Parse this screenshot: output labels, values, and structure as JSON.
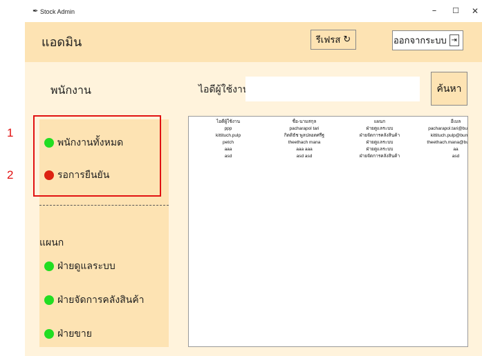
{
  "window": {
    "title": "Stock Admin",
    "minimize": "–",
    "maximize": "☐",
    "close": "✕"
  },
  "header": {
    "title": "แอดมิน",
    "refresh_label": "รีเฟรส",
    "refresh_icon_glyph": "↻",
    "logout_label": "ออกจากระบบ",
    "logout_icon_glyph": "⇥"
  },
  "main": {
    "section_title": "พนักงาน",
    "userid_label": "ไอดีผู้ใช้งาน",
    "userid_value": "",
    "search_label": "ค้นหา"
  },
  "sidebar": {
    "all_label": "พนักงานทั้งหมด",
    "pending_label": "รอการยืนยัน",
    "dept_title": "แผนก",
    "depts": [
      "ฝ่ายดูแลระบบ",
      "ฝ่ายจัดการคลังสินค้า",
      "ฝ่ายขาย"
    ]
  },
  "annotations": {
    "one": "1",
    "two": "2"
  },
  "table": {
    "headers": [
      "ไอดีผู้ใช้งาน",
      "ชื่อ-นามสกุล",
      "แผนก",
      "อีเมล"
    ],
    "rows": [
      [
        "ppp",
        "pacharapol tari",
        "ฝ่ายดูแลระบบ",
        "pacharapol.tari@bumail.net"
      ],
      [
        "kittituch.pulp",
        "กิตติธัช พูลปลอดศรีฐ",
        "ฝ่ายจัดการคลังสินค้า",
        "kittituch.pulp@bumail.net"
      ],
      [
        "petch",
        "theethach mana",
        "ฝ่ายดูแลระบบ",
        "theethach.mana@bumail.net"
      ],
      [
        "aaa",
        "aaa aaa",
        "ฝ่ายดูแลระบบ",
        "aa"
      ],
      [
        "asd",
        "asd asd",
        "ฝ่ายจัดการคลังสินค้า",
        "asd"
      ]
    ]
  },
  "colors": {
    "header_bg": "#fde3b3",
    "page_bg": "#fff3dc",
    "dot_green": "#22dd22",
    "dot_red": "#dd2211",
    "annotation_red": "#e11111"
  }
}
